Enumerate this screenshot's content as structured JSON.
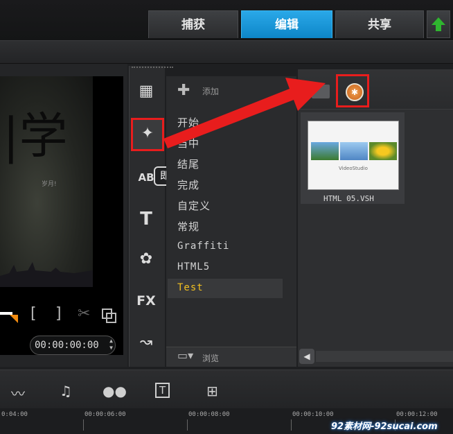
{
  "tabs": [
    {
      "label": "捕获",
      "active": false
    },
    {
      "label": "编辑",
      "active": true
    },
    {
      "label": "共享",
      "active": false
    }
  ],
  "preview": {
    "calligraphy": "|学",
    "small_text": "岁月!",
    "timecode": "00:00:00:00"
  },
  "toolstrip": {
    "tooltip": "即时项目"
  },
  "categories": {
    "add_label": "添加",
    "items": [
      "开始",
      "当中",
      "结尾",
      "完成",
      "自定义",
      "常规",
      "Graffiti",
      "HTML5",
      "Test"
    ],
    "selected": "Test",
    "browse_label": "浏览"
  },
  "library": {
    "thumb_label": "VideoStudio",
    "thumb_caption": "HTML 05.VSH"
  },
  "timeline": {
    "ticks": [
      "0:04:00",
      "00:00:06:00",
      "00:00:08:00",
      "00:00:10:00",
      "00:00:12:00"
    ]
  },
  "watermark": "92素材网-92sucai.com",
  "colors": {
    "accent": "#0d86c8",
    "highlight": "#e81d1d",
    "selected_text": "#f2c020"
  }
}
